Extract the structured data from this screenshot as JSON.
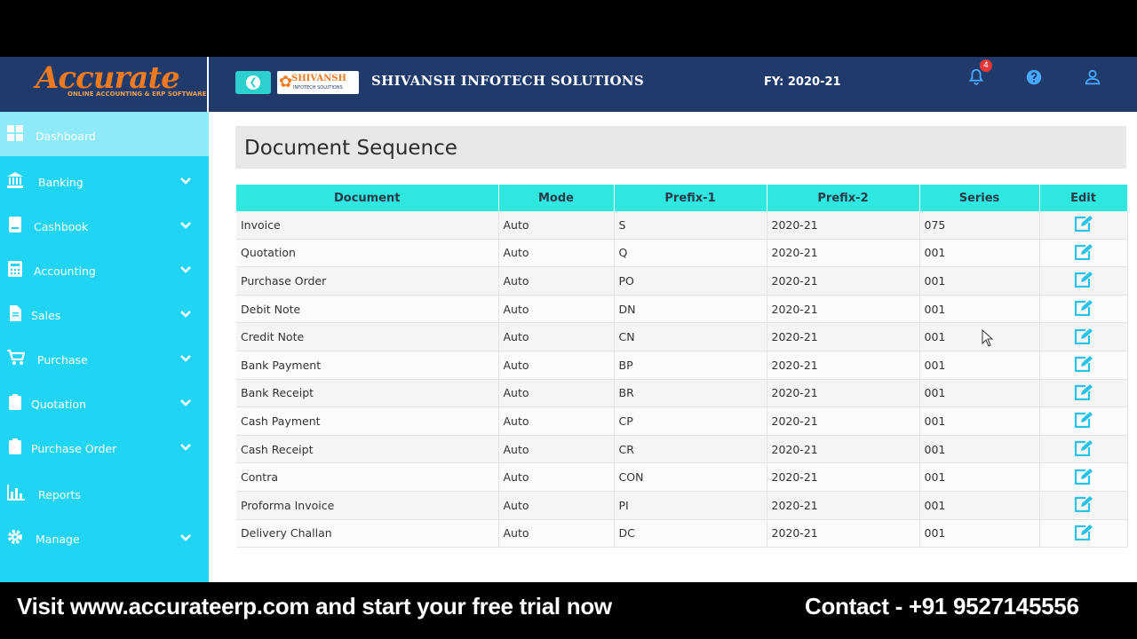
{
  "brand": {
    "logo_text": "Accurate",
    "logo_tagline": "ONLINE ACCOUNTING & ERP SOFTWARE"
  },
  "header": {
    "company_logo_text": "SHIVANSH",
    "company_logo_sub": "INFOTECH SOLUTIONS",
    "company_name": "SHIVANSH INFOTECH SOLUTIONS",
    "fy_label": "FY: 2020-21",
    "notification_count": "4",
    "icons": [
      "back-icon",
      "bell-icon",
      "help-icon",
      "user-icon"
    ]
  },
  "sidebar": {
    "items": [
      {
        "label": "Dashboard",
        "icon": "dashboard-icon",
        "expandable": false,
        "active": true
      },
      {
        "label": "Banking",
        "icon": "bank-icon",
        "expandable": true
      },
      {
        "label": "Cashbook",
        "icon": "cashbook-icon",
        "expandable": true
      },
      {
        "label": "Accounting",
        "icon": "calculator-icon",
        "expandable": true
      },
      {
        "label": "Sales",
        "icon": "document-icon",
        "expandable": true
      },
      {
        "label": "Purchase",
        "icon": "cart-icon",
        "expandable": true
      },
      {
        "label": "Quotation",
        "icon": "clipboard-icon",
        "expandable": true
      },
      {
        "label": "Purchase Order",
        "icon": "clipboard-icon",
        "expandable": true
      },
      {
        "label": "Reports",
        "icon": "bar-chart-icon",
        "expandable": false
      },
      {
        "label": "Manage",
        "icon": "gear-icon",
        "expandable": true
      }
    ]
  },
  "page": {
    "title": "Document Sequence",
    "table": {
      "headers": [
        "Document",
        "Mode",
        "Prefix-1",
        "Prefix-2",
        "Series",
        "Edit"
      ],
      "rows": [
        [
          "Invoice",
          "Auto",
          "S",
          "2020-21",
          "075"
        ],
        [
          "Quotation",
          "Auto",
          "Q",
          "2020-21",
          "001"
        ],
        [
          "Purchase Order",
          "Auto",
          "PO",
          "2020-21",
          "001"
        ],
        [
          "Debit Note",
          "Auto",
          "DN",
          "2020-21",
          "001"
        ],
        [
          "Credit Note",
          "Auto",
          "CN",
          "2020-21",
          "001"
        ],
        [
          "Bank Payment",
          "Auto",
          "BP",
          "2020-21",
          "001"
        ],
        [
          "Bank Receipt",
          "Auto",
          "BR",
          "2020-21",
          "001"
        ],
        [
          "Cash Payment",
          "Auto",
          "CP",
          "2020-21",
          "001"
        ],
        [
          "Cash Receipt",
          "Auto",
          "CR",
          "2020-21",
          "001"
        ],
        [
          "Contra",
          "Auto",
          "CON",
          "2020-21",
          "001"
        ],
        [
          "Proforma Invoice",
          "Auto",
          "PI",
          "2020-21",
          "001"
        ],
        [
          "Delivery Challan",
          "Auto",
          "DC",
          "2020-21",
          "001"
        ]
      ]
    }
  },
  "banner": {
    "left_text": "Visit www.accurateerp.com and start your free trial now",
    "right_text": "Contact - +91 9527145556"
  },
  "colors": {
    "header_bg": "#1f3a6b",
    "sidebar_bg": "#20d4f4",
    "sidebar_active": "#8ee9f8",
    "table_header": "#2ee8e0",
    "edit_icon": "#29c3e8",
    "logo_orange": "#f07a1e"
  }
}
